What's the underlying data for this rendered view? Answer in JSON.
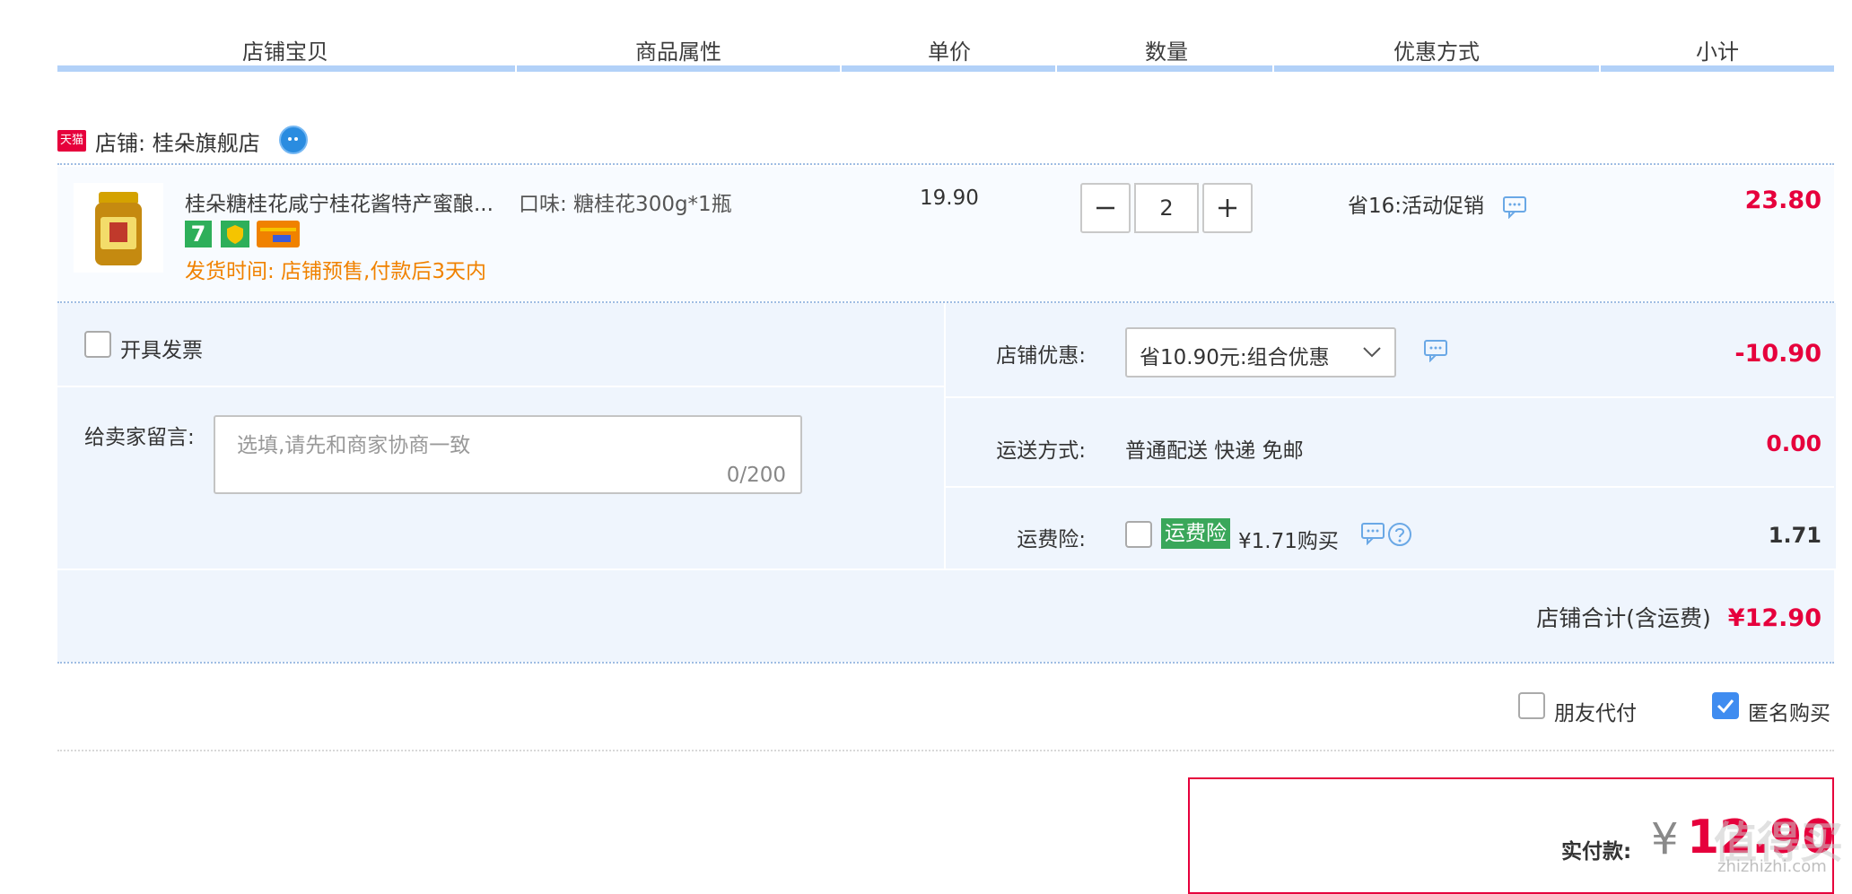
{
  "header": {
    "col_item": "店铺宝贝",
    "col_attr": "商品属性",
    "col_price": "单价",
    "col_qty": "数量",
    "col_promo": "优惠方式",
    "col_subtotal": "小计"
  },
  "shop": {
    "badge": "天猫",
    "name": "店铺: 桂朵旗舰店"
  },
  "product": {
    "title": "桂朵糖桂花咸宁桂花酱特产蜜酿...",
    "attr": "口味: 糖桂花300g*1瓶",
    "price": "19.90",
    "quantity": "2",
    "promo": "省16:活动促销",
    "subtotal": "23.80",
    "delivery": "发货时间: 店铺预售,付款后3天内",
    "badge_seven": "7"
  },
  "options": {
    "invoice_label": "开具发票",
    "message_label": "给卖家留言:",
    "message_placeholder": "选填,请先和商家协商一致",
    "message_counter": "0/200"
  },
  "discount": {
    "label": "店铺优惠:",
    "selected": "省10.90元:组合优惠",
    "amount": "-10.90"
  },
  "shipping": {
    "label": "运送方式:",
    "value": "普通配送 快递 免邮",
    "amount": "0.00"
  },
  "insurance": {
    "label": "运费险:",
    "tag": "运费险",
    "price_text": "¥1.71购买",
    "amount": "1.71"
  },
  "shop_total": {
    "label": "店铺合计(含运费)",
    "amount": "¥12.90"
  },
  "footer_opts": {
    "friend_pay": "朋友代付",
    "anonymous": "匿名购买",
    "anonymous_checked": true
  },
  "payment": {
    "label": "实付款:",
    "currency": "¥",
    "amount": "12.90"
  },
  "watermark": {
    "text": "值得买",
    "url": "zhizhizhi.com"
  },
  "colors": {
    "accent_red": "#e6003c",
    "header_bar": "#b2d1f8",
    "section_bg": "#eff5fd",
    "delivery_orange": "#f08200",
    "insurance_green": "#3aa75a",
    "check_blue": "#3f8cf0"
  }
}
